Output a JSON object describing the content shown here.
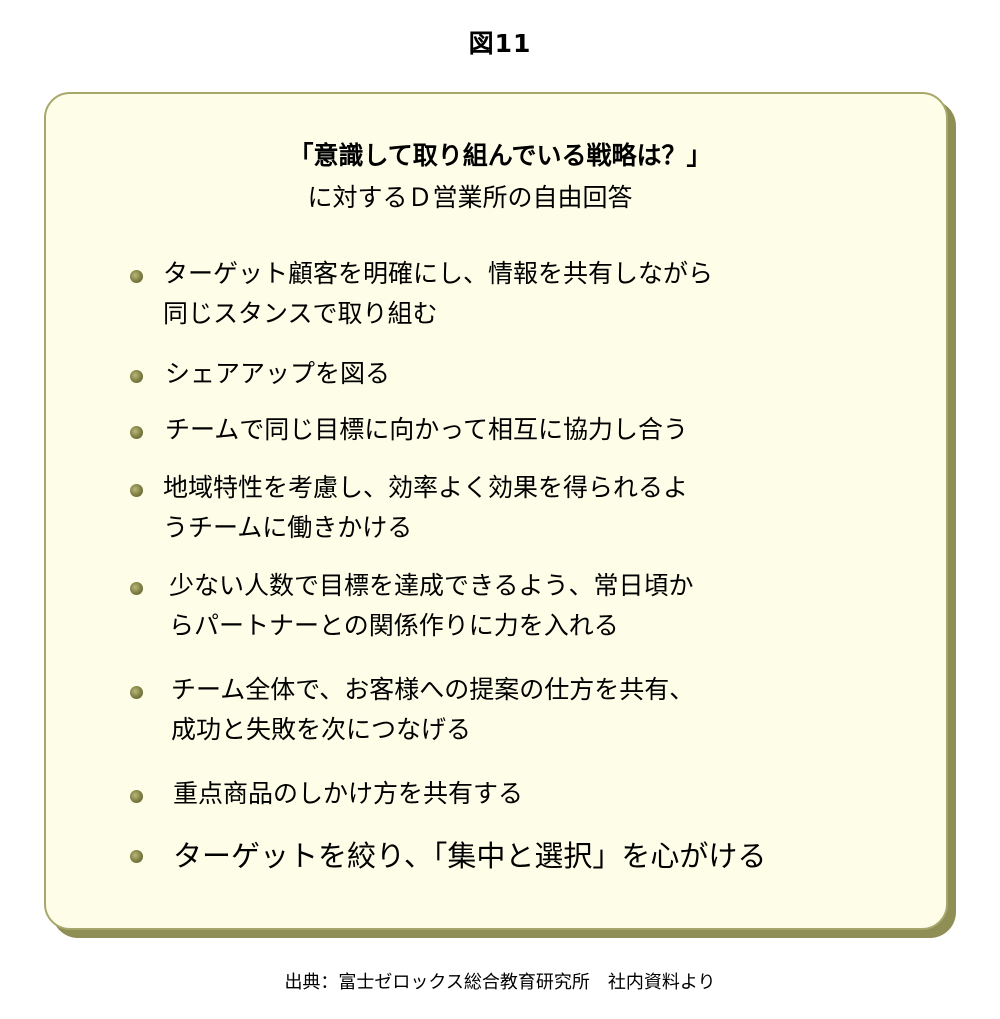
{
  "figure_label": "図11",
  "heading": "「意識して取り組んでいる戦略は？」",
  "subheading": "に対するＤ営業所の自由回答",
  "items": [
    "ターゲット顧客を明確にし、情報を共有しながら\n同じスタンスで取り組む",
    "シェアアップを図る",
    "チームで同じ目標に向かって相互に協力し合う",
    "地域特性を考慮し、効率よく効果を得られるよ\nうチームに働きかける",
    "少ない人数で目標を達成できるよう、常日頃か\nらパートナーとの関係作りに力を入れる",
    "チーム全体で、お客様への提案の仕方を共有、\n成功と失敗を次につなげる",
    "重点商品のしかけ方を共有する",
    "ターゲットを絞り、「集中と選択」を心がける"
  ],
  "source": "出典：富士ゼロックス総合教育研究所　社内資料より",
  "colors": {
    "panel_fill": "#fdfde8",
    "panel_border": "#a7a76c",
    "panel_shadow": "#8f8f55",
    "bullet": "#7c7c42"
  }
}
